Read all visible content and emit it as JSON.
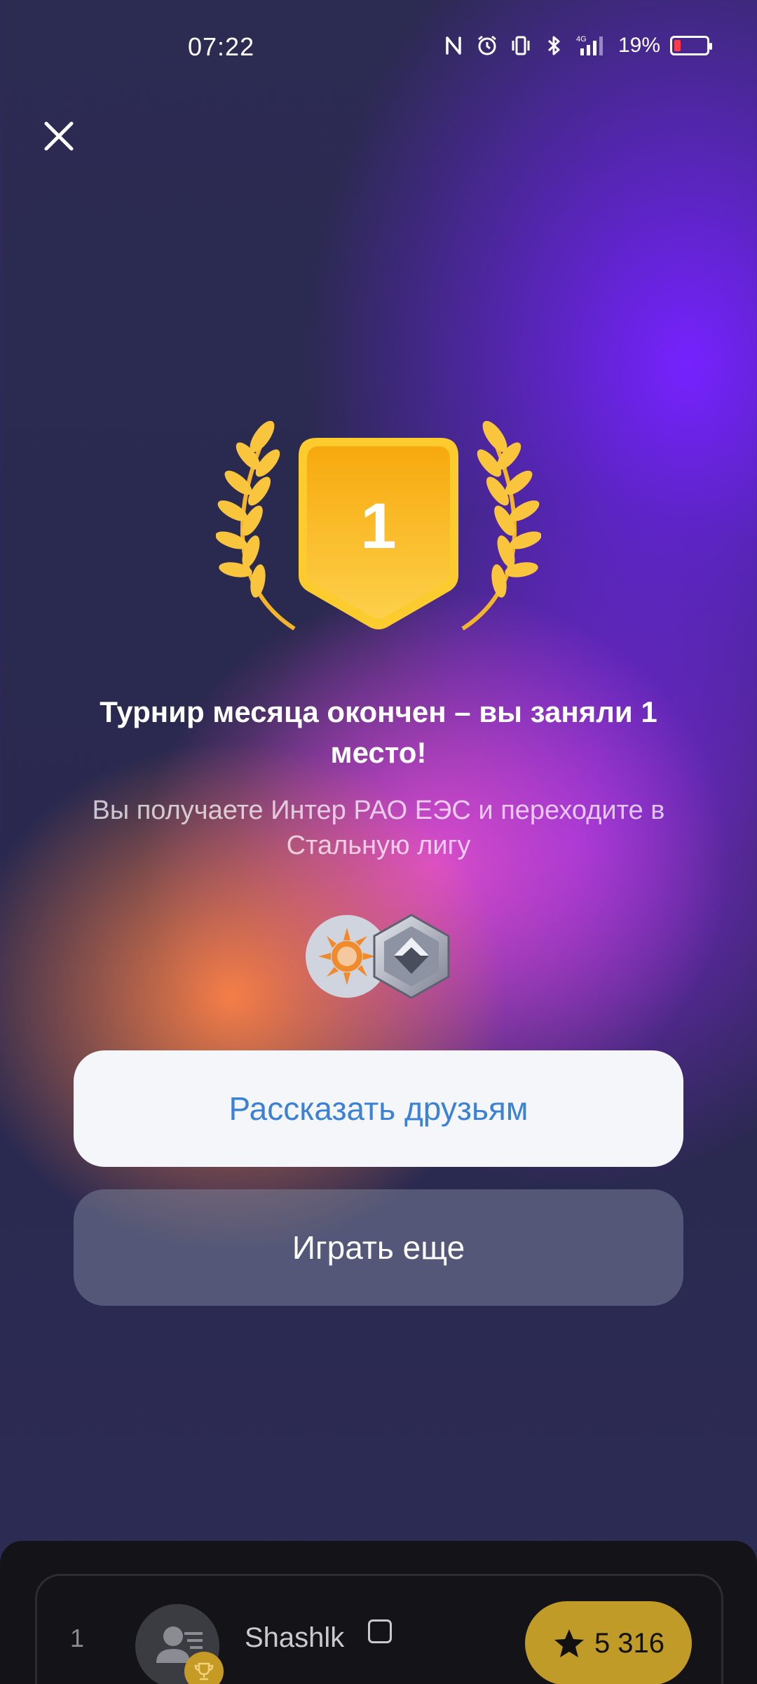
{
  "status_bar": {
    "time": "07:22",
    "network": "4G",
    "battery_percent": "19%",
    "icons": [
      "nfc-icon",
      "alarm-icon",
      "vibrate-icon",
      "bluetooth-icon",
      "signal-icon",
      "battery-icon"
    ]
  },
  "result": {
    "place": "1",
    "title": "Турнир месяца окончен – вы заняли 1 место!",
    "subtitle": "Вы получаете Интер РАО ЕЭС и переходите в Стальную лигу"
  },
  "buttons": {
    "share_label": "Рассказать друзьям",
    "play_label": "Играть еще"
  },
  "leaderboard_row": {
    "rank": "1",
    "name": "Shashlk",
    "score": "5 316"
  },
  "colors": {
    "accent_blue": "#3b82d6",
    "gold": "#f9b816",
    "score_pill": "#c19b27",
    "battery_low": "#ff3b4a"
  }
}
